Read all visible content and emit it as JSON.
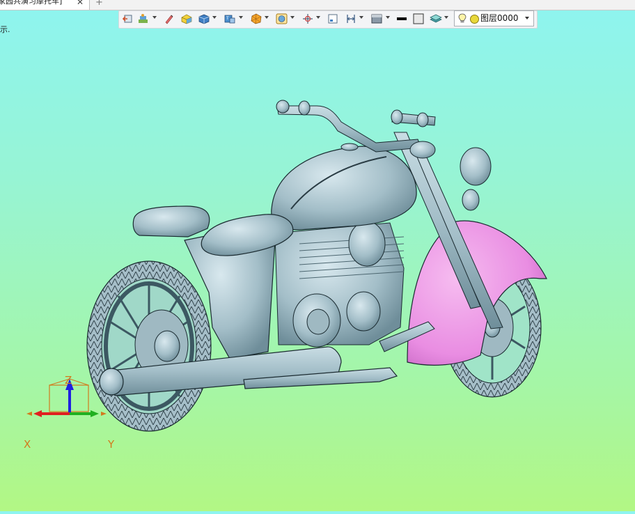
{
  "document_tab": {
    "title": "家园共演习摩托车]",
    "close_glyph": "✕",
    "new_tab_glyph": "+"
  },
  "status": {
    "hint": "示."
  },
  "toolbar": {
    "tools": [
      "view-icon",
      "display-mode-icon",
      "pencil-icon",
      "shade-box-icon",
      "solid-cube-icon",
      "view-cube-icon",
      "polygon-icon",
      "render-icon",
      "snap-icon",
      "small-frame-icon",
      "dimension-icon",
      "material-icon",
      "line-color-icon",
      "fill-color-icon",
      "layer-stack-icon"
    ],
    "layer": {
      "value": "图层0000",
      "bulb_icon": "bulb-icon",
      "color": "#e8d83a"
    }
  },
  "triad": {
    "x_label": "X",
    "y_label": "Y",
    "z_label": "Z",
    "colors": {
      "x": "#e02020",
      "y": "#20b020",
      "z": "#2020e0",
      "text": "#d27a1d"
    }
  },
  "model": {
    "body_color": "#a9c4cc",
    "fender_color": "#e98de2",
    "outline_color": "#1a2a30"
  }
}
